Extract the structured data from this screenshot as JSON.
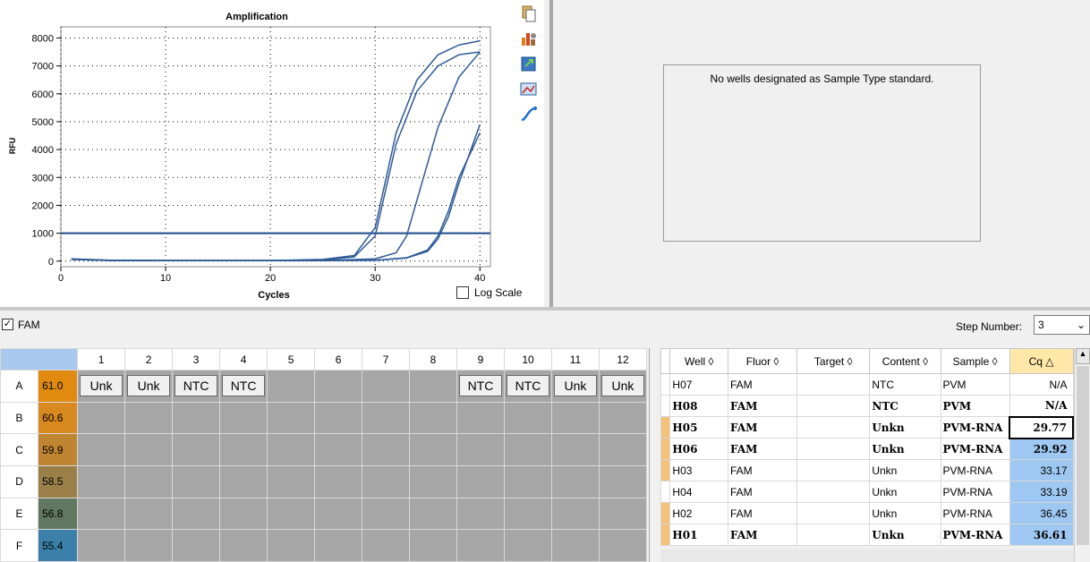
{
  "chart": {
    "title": "Amplification",
    "ylabel": "RFU",
    "xlabel": "Cycles",
    "log_scale_label": "Log Scale",
    "log_scale_checked": false,
    "yticks": [
      "8000",
      "7000",
      "6000",
      "5000",
      "4000",
      "3000",
      "2000",
      "1000",
      "0"
    ],
    "xticks": [
      "0",
      "10",
      "20",
      "30",
      "40"
    ],
    "toolbar_icons": [
      "copy-icon",
      "chart-settings-icon",
      "export-icon",
      "image-icon",
      "curve-icon"
    ]
  },
  "chart_data": {
    "type": "line",
    "title": "Amplification",
    "xlabel": "Cycles",
    "ylabel": "RFU",
    "xlim": [
      0,
      41
    ],
    "ylim": [
      -200,
      8400
    ],
    "grid": true,
    "threshold": 1000,
    "series": [
      {
        "x": [
          1,
          5,
          10,
          15,
          20,
          25,
          28,
          30,
          32,
          34,
          36,
          38,
          40
        ],
        "y": [
          80,
          30,
          20,
          20,
          20,
          60,
          200,
          1200,
          4600,
          6500,
          7400,
          7750,
          7900
        ]
      },
      {
        "x": [
          1,
          5,
          10,
          15,
          20,
          25,
          28,
          30,
          32,
          34,
          36,
          38,
          40
        ],
        "y": [
          70,
          25,
          20,
          20,
          20,
          40,
          150,
          900,
          4200,
          6100,
          7000,
          7400,
          7500
        ]
      },
      {
        "x": [
          1,
          5,
          10,
          15,
          20,
          25,
          30,
          32,
          33,
          34,
          36,
          38,
          40
        ],
        "y": [
          60,
          20,
          20,
          20,
          20,
          20,
          80,
          300,
          900,
          2200,
          4800,
          6600,
          7500
        ]
      },
      {
        "x": [
          1,
          5,
          10,
          15,
          20,
          25,
          30,
          33,
          35,
          36,
          37,
          38,
          40
        ],
        "y": [
          60,
          20,
          20,
          20,
          20,
          20,
          30,
          120,
          400,
          900,
          1800,
          3000,
          4600
        ]
      },
      {
        "x": [
          1,
          5,
          10,
          15,
          20,
          25,
          30,
          33,
          35,
          36,
          37,
          38,
          40
        ],
        "y": [
          60,
          20,
          20,
          20,
          20,
          20,
          30,
          110,
          350,
          800,
          1600,
          2800,
          4900
        ]
      }
    ]
  },
  "standard": {
    "message": "No wells designated as Sample Type standard."
  },
  "fluor_filter": {
    "label": "FAM",
    "checked": true
  },
  "step": {
    "label": "Step Number:",
    "value": "3"
  },
  "plate": {
    "columns": [
      "1",
      "2",
      "3",
      "4",
      "5",
      "6",
      "7",
      "8",
      "9",
      "10",
      "11",
      "12"
    ],
    "rows": [
      {
        "label": "A",
        "temp": "61.0",
        "color": "#e08a10",
        "wells": [
          "Unk",
          "Unk",
          "NTC",
          "NTC",
          "",
          "",
          "",
          "",
          "NTC",
          "NTC",
          "Unk",
          "Unk"
        ]
      },
      {
        "label": "B",
        "temp": "60.6",
        "color": "#d88a20",
        "wells": [
          "",
          "",
          "",
          "",
          "",
          "",
          "",
          "",
          "",
          "",
          "",
          ""
        ]
      },
      {
        "label": "C",
        "temp": "59.9",
        "color": "#c08530",
        "wells": [
          "",
          "",
          "",
          "",
          "",
          "",
          "",
          "",
          "",
          "",
          "",
          ""
        ]
      },
      {
        "label": "D",
        "temp": "58.5",
        "color": "#9a8048",
        "wells": [
          "",
          "",
          "",
          "",
          "",
          "",
          "",
          "",
          "",
          "",
          "",
          ""
        ]
      },
      {
        "label": "E",
        "temp": "56.8",
        "color": "#607860",
        "wells": [
          "",
          "",
          "",
          "",
          "",
          "",
          "",
          "",
          "",
          "",
          "",
          ""
        ]
      },
      {
        "label": "F",
        "temp": "55.4",
        "color": "#3a80a8",
        "wells": [
          "",
          "",
          "",
          "",
          "",
          "",
          "",
          "",
          "",
          "",
          "",
          ""
        ]
      }
    ]
  },
  "results": {
    "headers": [
      "Well",
      "Fluor",
      "Target",
      "Content",
      "Sample",
      "Cq"
    ],
    "rows": [
      {
        "well": "H07",
        "fluor": "FAM",
        "target": "",
        "content": "NTC",
        "sample": "PVM",
        "cq": "N/A",
        "marker": false,
        "hl": false,
        "boxed": false,
        "mono": false
      },
      {
        "well": "H08",
        "fluor": "FAM",
        "target": "",
        "content": "NTC",
        "sample": "PVM",
        "cq": "N/A",
        "marker": false,
        "hl": false,
        "boxed": false,
        "mono": true
      },
      {
        "well": "H05",
        "fluor": "FAM",
        "target": "",
        "content": "Unkn",
        "sample": "PVM-RNA",
        "cq": "29.77",
        "marker": true,
        "hl": false,
        "boxed": true,
        "mono": true
      },
      {
        "well": "H06",
        "fluor": "FAM",
        "target": "",
        "content": "Unkn",
        "sample": "PVM-RNA",
        "cq": "29.92",
        "marker": true,
        "hl": true,
        "boxed": false,
        "mono": true
      },
      {
        "well": "H03",
        "fluor": "FAM",
        "target": "",
        "content": "Unkn",
        "sample": "PVM-RNA",
        "cq": "33.17",
        "marker": true,
        "hl": true,
        "boxed": false,
        "mono": false
      },
      {
        "well": "H04",
        "fluor": "FAM",
        "target": "",
        "content": "Unkn",
        "sample": "PVM-RNA",
        "cq": "33.19",
        "marker": false,
        "hl": true,
        "boxed": false,
        "mono": false
      },
      {
        "well": "H02",
        "fluor": "FAM",
        "target": "",
        "content": "Unkn",
        "sample": "PVM-RNA",
        "cq": "36.45",
        "marker": true,
        "hl": true,
        "boxed": false,
        "mono": false
      },
      {
        "well": "H01",
        "fluor": "FAM",
        "target": "",
        "content": "Unkn",
        "sample": "PVM-RNA",
        "cq": "36.61",
        "marker": true,
        "hl": true,
        "boxed": false,
        "mono": true
      }
    ]
  },
  "colors": {
    "curve": "#2e5a96",
    "threshold": "#1a4a8a",
    "row_marker": "#f5c07a",
    "cq_highlight": "#9ec8f2"
  }
}
